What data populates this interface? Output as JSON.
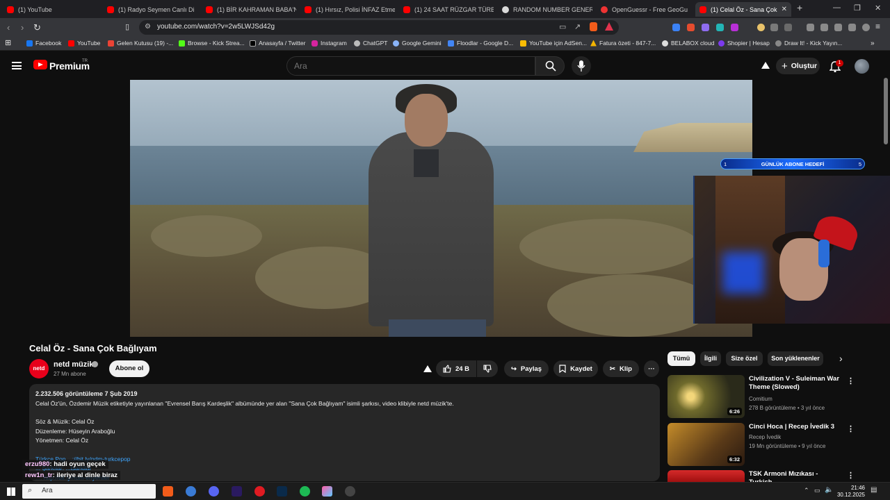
{
  "browser": {
    "tabs": [
      {
        "label": "(1) YouTube",
        "fav": "yt"
      },
      {
        "label": "(1) Radyo Seymen Canlı Di",
        "fav": "yt"
      },
      {
        "label": "(1) BİR KAHRAMAN BABA'NIN",
        "fav": "yt"
      },
      {
        "label": "(1) Hırsız, Polisi İNFAZ Etmeye",
        "fav": "yt"
      },
      {
        "label": "(1) 24 SAAT RÜZGAR TÜRBİNİ",
        "fav": "yt"
      },
      {
        "label": "RANDOM NUMBER GENERATO",
        "fav": "g"
      },
      {
        "label": "OpenGuessr - Free GeoGu",
        "fav": "og"
      },
      {
        "label": "(1) Celal Öz - Sana Çok",
        "fav": "yt"
      }
    ],
    "url": "youtube.com/watch?v=2w5LWJSd42g",
    "bookmarks": [
      "Facebook",
      "YouTube",
      "Gelen Kutusu (19) -...",
      "Browse - Kick Strea...",
      "Anasayfa / Twitter",
      "Instagram",
      "ChatGPT",
      "Google Gemini",
      "Floodlar - Google D...",
      "YouTube için AdSen...",
      "Fatura özeti - 847-7...",
      "BELABOX cloud",
      "Shopier | Hesap",
      "Draw It! - Kick Yayın..."
    ]
  },
  "header": {
    "brand": "Premium",
    "brand_sup": "TR",
    "search_placeholder": "Ara",
    "create_label": "Oluştur",
    "notif_count": "1"
  },
  "overlay": {
    "goal_left": "1",
    "goal_label": "GÜNLÜK ABONE HEDEFİ",
    "goal_right": "5"
  },
  "video": {
    "title": "Celal Öz - Sana Çok Bağlıyam",
    "channel": "netd müzik",
    "channel_avatar": "netd",
    "subs": "27 Mn abone",
    "subscribe": "Abone ol",
    "likes": "24 B",
    "share": "Paylaş",
    "save": "Kaydet",
    "clip": "Klip"
  },
  "description": {
    "meta": "2.232.506 görüntüleme  7 Şub 2019",
    "line1": "Celal Öz'ün, Özdemir Müzik etiketiyle yayınlanan \"Evrensel Barış Kardeşlik\" albümünde yer alan \"Sana Çok Bağlıyam\" isimli şarkısı, video klibiyle netd müzik'te.",
    "line2": "Söz & Müzik: Celal Öz",
    "line3": "Düzenleme: Hüseyin Araboğlu",
    "line4": "Yönetmen: Celal Öz",
    "link1": "Türkçe Pop ...://bit.ly/ndm-turkcepop",
    "link2": "... Şarkılar: ...tsarkilar",
    "link3": "...: http://bit.ly/ndm-enyeniler"
  },
  "chat": [
    {
      "user": "erzu980",
      "msg": ": hadi oyun geçek"
    },
    {
      "user": "rew1n_tr",
      "msg": ": ileriye al dinle biraz"
    }
  ],
  "chips": [
    "Tümü",
    "İlgili",
    "Size özel",
    "Son yüklenenler"
  ],
  "recs": [
    {
      "title": "Civilization V - Suleiman War Theme (Slowed)",
      "channel": "Comitium",
      "meta": "278 B görüntüleme • 3 yıl önce",
      "duration": "6:26"
    },
    {
      "title": "Cinci Hoca | Recep İvedik 3",
      "channel": "Recep İvedik",
      "meta": "19 Mn görüntüleme • 9 yıl önce",
      "duration": "6:32"
    },
    {
      "title": "TSK Armoni Mızıkası - Turkish",
      "channel": "",
      "meta": "",
      "duration": ""
    }
  ],
  "taskbar": {
    "search_placeholder": "Ara",
    "time": "21:46",
    "date": "30.12.2025"
  }
}
